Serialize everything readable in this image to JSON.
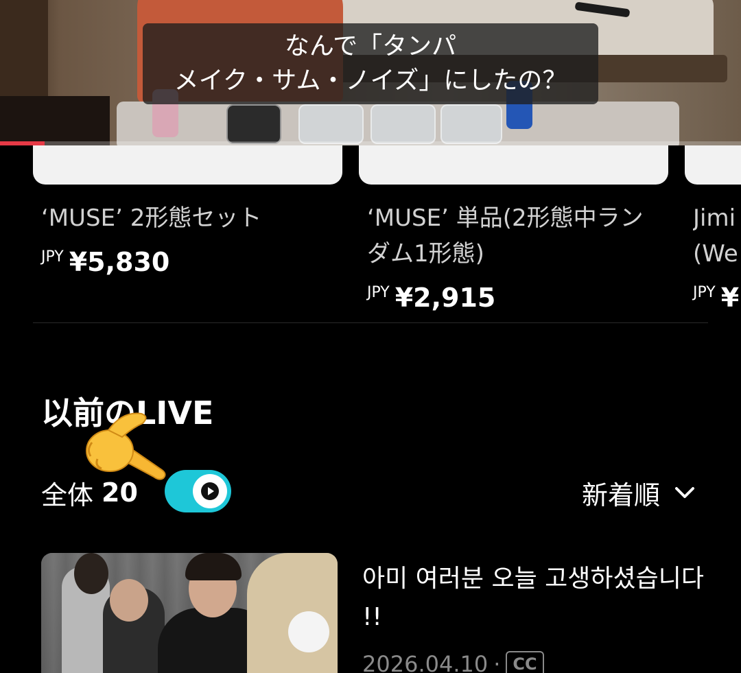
{
  "video": {
    "subtitle_line1": "なんで「タンパ",
    "subtitle_line2": "メイク・サム・ノイズ」にしたの？",
    "progress_fraction": 0.06,
    "progress_color": "#e63946"
  },
  "products": [
    {
      "name": "‘MUSE’ 2形態セット",
      "currency": "JPY",
      "price": "¥5,830"
    },
    {
      "name": "‘MUSE’ 単品(2形態中ランダム1形態)",
      "currency": "JPY",
      "price": "¥2,915"
    },
    {
      "name": "Jimi (We",
      "currency": "JPY",
      "price": "¥"
    }
  ],
  "previous_live": {
    "title": "以前のLIVE",
    "total_label": "全体",
    "total_count": "20",
    "toggle_icon": "play-icon",
    "toggle_on": true,
    "toggle_color": "#1ec7d8",
    "pointer_icon": "pointing-hand-emoji",
    "sort_label": "新着順",
    "sort_icon": "chevron-down-icon"
  },
  "videos": [
    {
      "title": "아미 여러분 오늘 고생하셨습니다 !!",
      "date": "2026.04.10",
      "separator": "·",
      "badge": "CC"
    }
  ]
}
